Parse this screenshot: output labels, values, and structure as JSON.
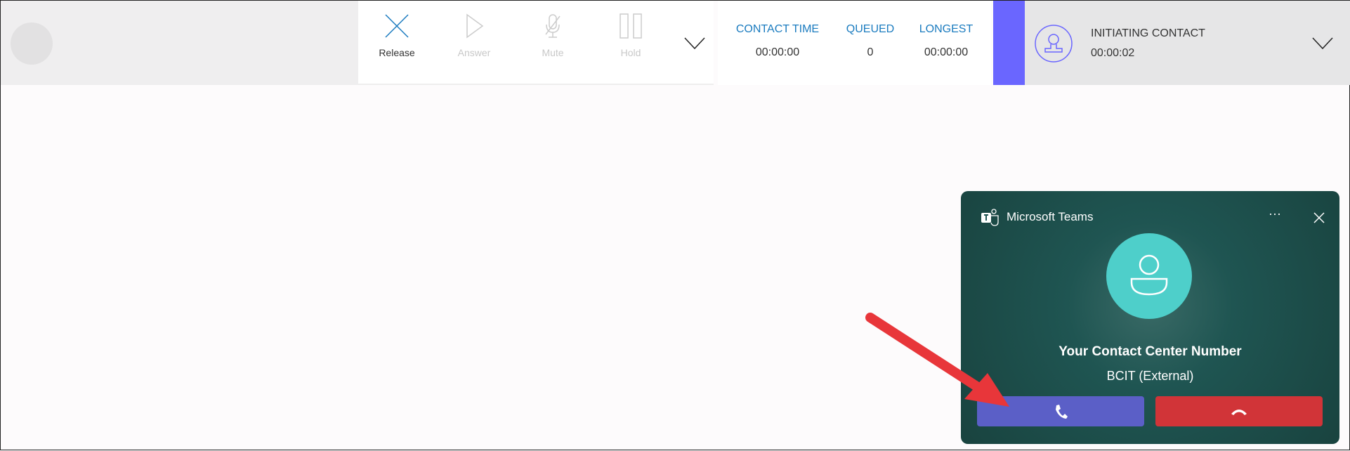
{
  "toolbar": {
    "buttons": [
      {
        "label": "Release",
        "icon": "x-icon",
        "enabled": true
      },
      {
        "label": "Answer",
        "icon": "play-icon",
        "enabled": false
      },
      {
        "label": "Mute",
        "icon": "microphone-off-icon",
        "enabled": false
      },
      {
        "label": "Hold",
        "icon": "pause-icon",
        "enabled": false
      }
    ]
  },
  "stats": [
    {
      "label": "CONTACT TIME",
      "value": "00:00:00"
    },
    {
      "label": "QUEUED",
      "value": "0"
    },
    {
      "label": "LONGEST",
      "value": "00:00:00"
    }
  ],
  "status": {
    "title": "INITIATING CONTACT",
    "timer": "00:00:02",
    "accent": "#6a66ff"
  },
  "teams": {
    "app_title": "Microsoft Teams",
    "caller_name": "Your Contact Center Number",
    "caller_sub": "BCIT (External)",
    "accept_color": "#5b5fc7",
    "decline_color": "#d13438"
  }
}
